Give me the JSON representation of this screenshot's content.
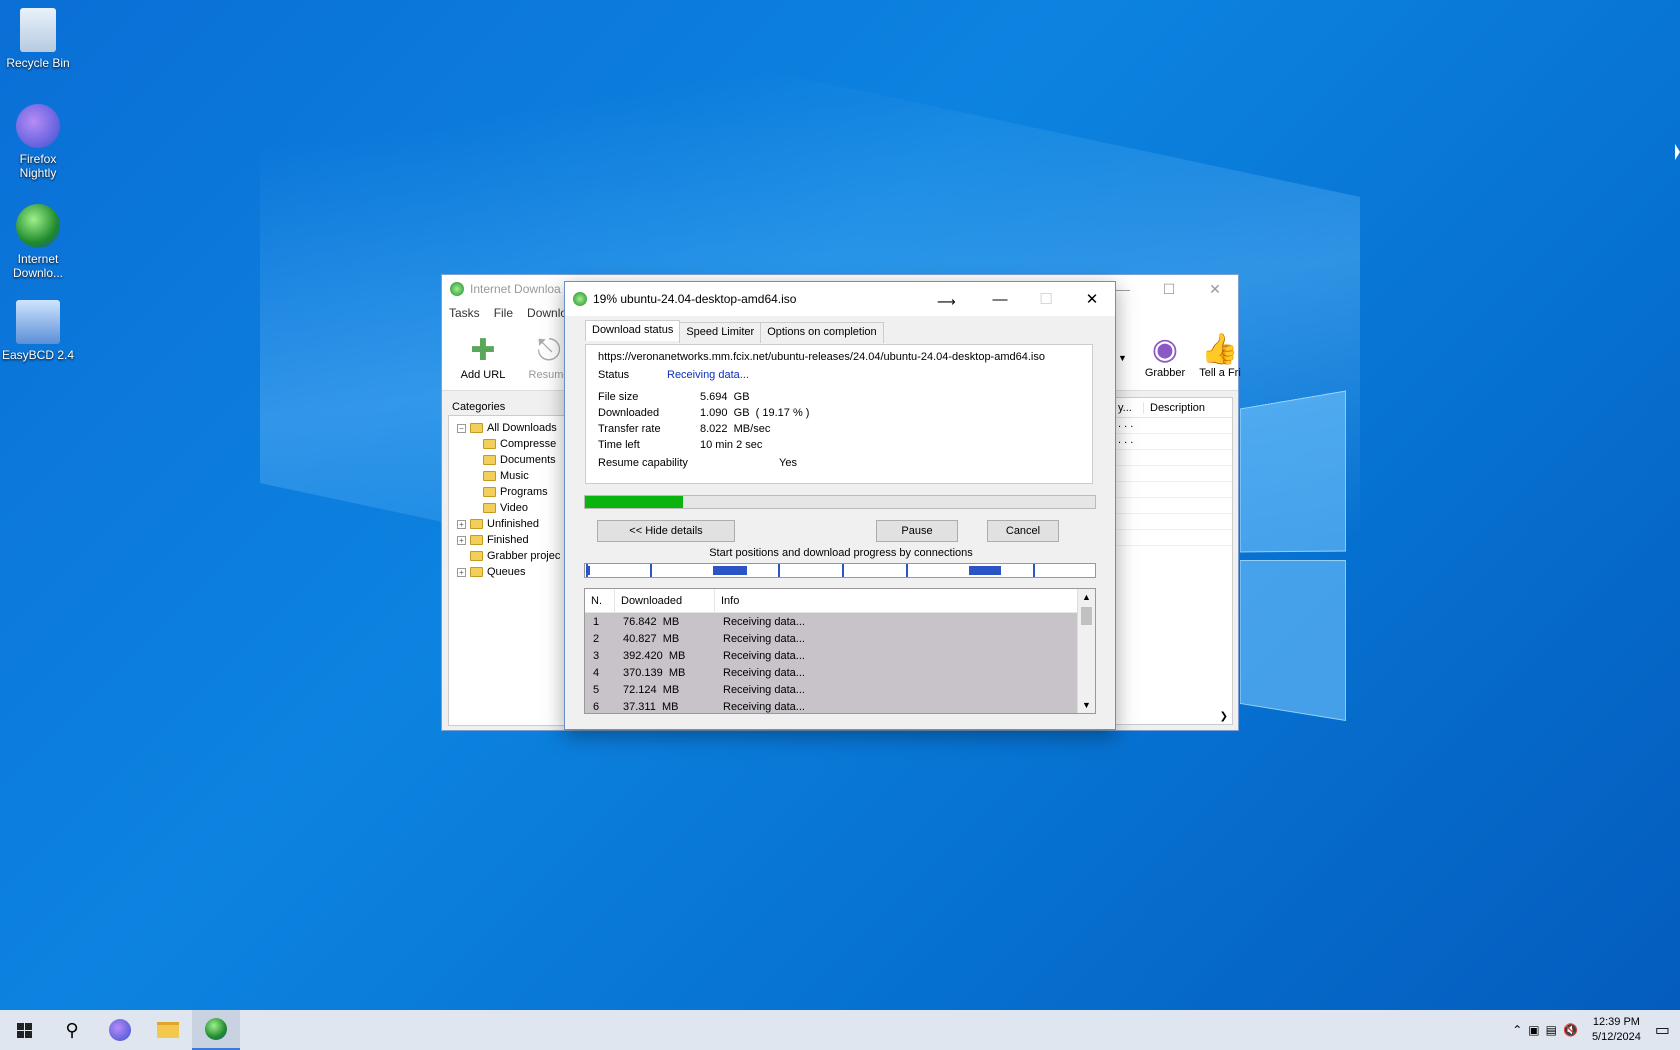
{
  "desktop": {
    "icons": [
      {
        "label": "Recycle Bin",
        "icon": "recycle-bin-icon"
      },
      {
        "label": "Firefox Nightly",
        "icon": "firefox-nightly-icon"
      },
      {
        "label": "Internet Downlo...",
        "icon": "idm-icon"
      },
      {
        "label": "EasyBCD 2.4",
        "icon": "easybcd-icon"
      }
    ]
  },
  "idm_window": {
    "title": "Internet Downloa",
    "menu": [
      "Tasks",
      "File",
      "Downlo"
    ],
    "toolbar": {
      "add_url": "Add URL",
      "resume": "Resume",
      "grabber": "Grabber",
      "tell_friend": "Tell a Fri"
    },
    "categories_title": "Categories",
    "categories": [
      {
        "label": "All Downloads",
        "level": 0,
        "expander": "−"
      },
      {
        "label": "Compresse",
        "level": 1
      },
      {
        "label": "Documents",
        "level": 1
      },
      {
        "label": "Music",
        "level": 1
      },
      {
        "label": "Programs",
        "level": 1
      },
      {
        "label": "Video",
        "level": 1
      },
      {
        "label": "Unfinished",
        "level": 0,
        "expander": "+"
      },
      {
        "label": "Finished",
        "level": 0,
        "expander": "+"
      },
      {
        "label": "Grabber projec",
        "level": 0
      },
      {
        "label": "Queues",
        "level": 0,
        "expander": "+"
      }
    ],
    "list_headers": {
      "col1": "y...",
      "description": "Description"
    },
    "list_rows": [
      ". . .",
      ". . ."
    ]
  },
  "dialog": {
    "title": "19% ubuntu-24.04-desktop-amd64.iso",
    "tabs": [
      "Download status",
      "Speed Limiter",
      "Options on completion"
    ],
    "url": "https://veronanetworks.mm.fcix.net/ubuntu-releases/24.04/ubuntu-24.04-desktop-amd64.iso",
    "status_label": "Status",
    "status_value": "Receiving data...",
    "file_size_label": "File size",
    "file_size_value": "5.694  GB",
    "downloaded_label": "Downloaded",
    "downloaded_value": "1.090  GB  ( 19.17 % )",
    "transfer_rate_label": "Transfer rate",
    "transfer_rate_value": "8.022  MB/sec",
    "time_left_label": "Time left",
    "time_left_value": "10 min 2 sec",
    "resume_label": "Resume capability",
    "resume_value": "Yes",
    "progress_percent": 19.17,
    "hide_details": "<< Hide details",
    "pause": "Pause",
    "cancel": "Cancel",
    "connections_label": "Start positions and download progress by connections",
    "conn_headers": {
      "n": "N.",
      "downloaded": "Downloaded",
      "info": "Info"
    },
    "connections": [
      {
        "n": "1",
        "downloaded": "76.842  MB",
        "info": "Receiving data..."
      },
      {
        "n": "2",
        "downloaded": "40.827  MB",
        "info": "Receiving data..."
      },
      {
        "n": "3",
        "downloaded": "392.420  MB",
        "info": "Receiving data..."
      },
      {
        "n": "4",
        "downloaded": "370.139  MB",
        "info": "Receiving data..."
      },
      {
        "n": "5",
        "downloaded": "72.124  MB",
        "info": "Receiving data..."
      },
      {
        "n": "6",
        "downloaded": "37.311  MB",
        "info": "Receiving data..."
      }
    ]
  },
  "taskbar": {
    "time": "12:39 PM",
    "date": "5/12/2024"
  },
  "colors": {
    "accent": "#0a6fd6",
    "progress": "#09b40f",
    "segment": "#2b55c7",
    "status_link": "#0a2fbd"
  }
}
